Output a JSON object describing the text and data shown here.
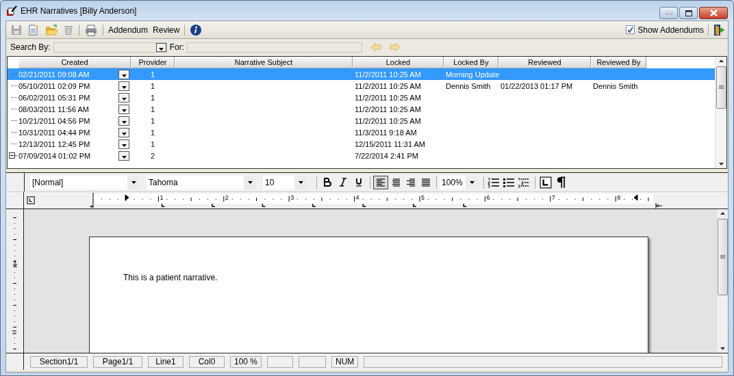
{
  "window": {
    "title": "EHR Narratives [Billy Anderson]"
  },
  "toolbar": {
    "items": [
      {
        "kind": "save",
        "disabled": true
      },
      {
        "kind": "new",
        "disabled": false
      },
      {
        "kind": "open",
        "disabled": false
      },
      {
        "kind": "delete",
        "disabled": true
      },
      {
        "kind": "separator"
      },
      {
        "kind": "print",
        "disabled": false
      },
      {
        "kind": "separator"
      },
      {
        "kind": "text",
        "label": "Addendum"
      },
      {
        "kind": "text",
        "label": "Review"
      },
      {
        "kind": "separator"
      },
      {
        "kind": "info"
      }
    ],
    "show_addendums": {
      "label": "Show Addendums",
      "checked": true
    }
  },
  "search": {
    "label": "Search By:",
    "for_label": "For:",
    "nav": [
      {
        "kind": "back",
        "disabled": true
      },
      {
        "kind": "forward",
        "disabled": true
      }
    ]
  },
  "grid": {
    "columns": [
      "Created",
      "Provider",
      "Narrative Subject",
      "Locked",
      "Locked By",
      "Reviewed",
      "Reviewed By"
    ],
    "rows": [
      {
        "created": "02/21/2011 09:08 AM",
        "provider": "1",
        "locked": "11/2/2011 10:25 AM",
        "locked_by": "Morning Update",
        "selected": true
      },
      {
        "created": "05/10/2011 02:09 PM",
        "provider": "1",
        "locked": "11/2/2011 10:25 AM",
        "locked_by": "Dennis Smith",
        "reviewed": "01/22/2013 01:17 PM",
        "reviewed_by": "Dennis Smith",
        "selected": false
      },
      {
        "created": "06/02/2011 05:31 PM",
        "provider": "1",
        "locked": "11/2/2011 10:25 AM",
        "selected": false
      },
      {
        "created": "08/03/2011 11:56 AM",
        "provider": "1",
        "locked": "11/2/2011 10:25 AM",
        "selected": false
      },
      {
        "created": "10/21/2011 04:56 PM",
        "provider": "1",
        "locked": "11/2/2011 10:25 AM",
        "selected": false
      },
      {
        "created": "10/31/2011 04:44 PM",
        "provider": "1",
        "locked": "11/3/2011 9:18 AM",
        "selected": false
      },
      {
        "created": "12/13/2011 12:45 PM",
        "provider": "1",
        "locked": "12/15/2011 11:31 AM",
        "selected": false
      },
      {
        "created": "07/09/2014 01:02 PM",
        "provider": "2",
        "locked": "7/22/2014 2:41 PM",
        "selected": false,
        "expanded": true
      }
    ]
  },
  "editor": {
    "style": "[Normal]",
    "font": "Tahoma",
    "size": "10",
    "zoom": "100%",
    "formats": [
      {
        "kind": "bold",
        "on": false
      },
      {
        "kind": "italic",
        "on": false
      },
      {
        "kind": "underline",
        "on": false
      }
    ],
    "alignments": [
      {
        "kind": "left",
        "selected": true
      },
      {
        "kind": "center",
        "selected": false
      },
      {
        "kind": "right",
        "selected": false
      },
      {
        "kind": "justify",
        "selected": false
      }
    ],
    "ruler": [
      "1",
      "2",
      "3",
      "4",
      "5",
      "6",
      "7",
      "8"
    ],
    "document_text": "This is a patient narrative."
  },
  "status_bar": [
    {
      "kind": "text",
      "text": "Section1/1"
    },
    {
      "kind": "text",
      "text": "Page1/1"
    },
    {
      "kind": "text",
      "text": "Line1"
    },
    {
      "kind": "text",
      "text": "Col0"
    },
    {
      "kind": "text",
      "text": "100 %"
    },
    {
      "kind": "empty"
    },
    {
      "kind": "empty"
    },
    {
      "kind": "text",
      "text": "NUM"
    },
    {
      "kind": "empty"
    }
  ]
}
